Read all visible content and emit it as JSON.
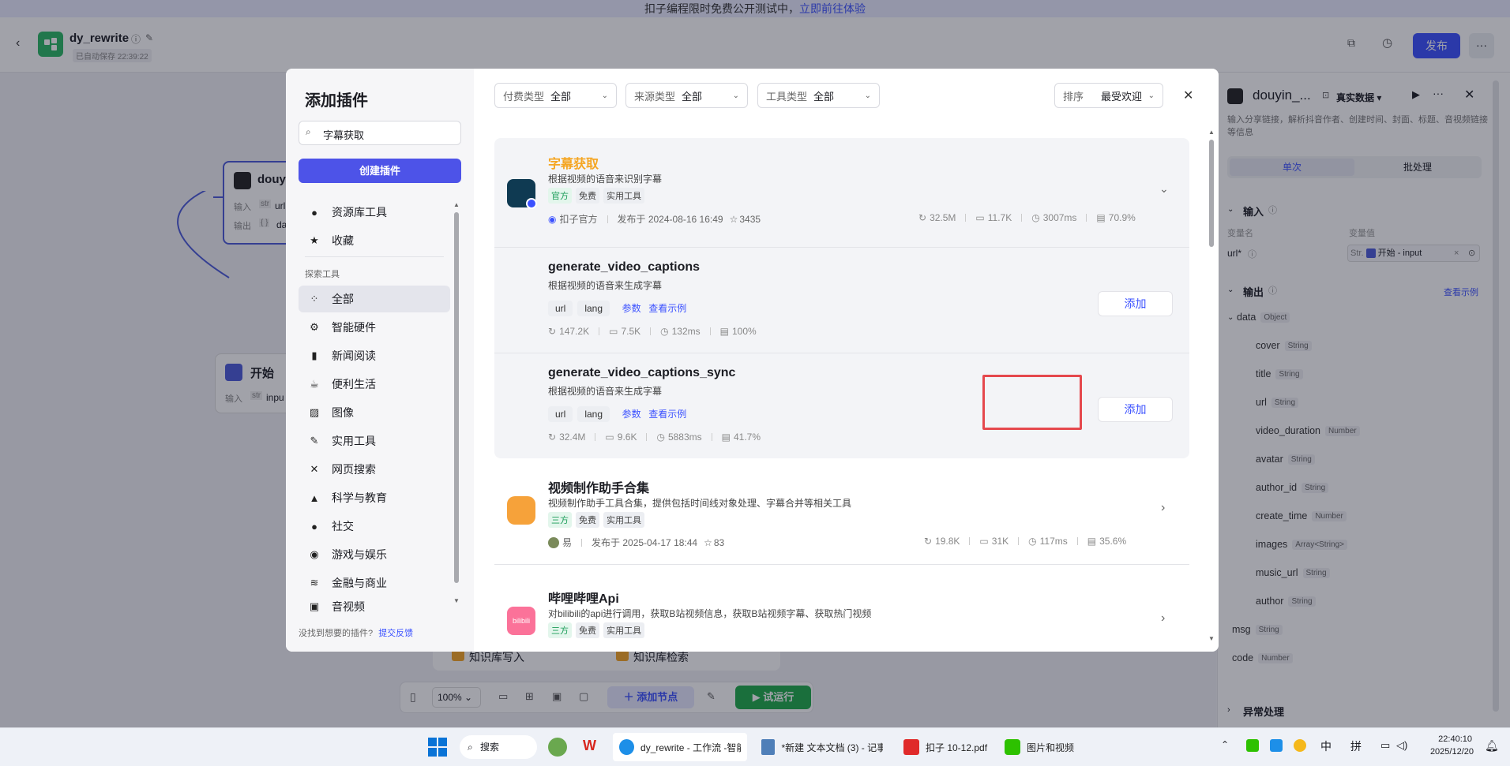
{
  "banner": {
    "text": "扣子编程限时免费公开测试中，",
    "link": "立即前往体验"
  },
  "topbar": {
    "app_name": "dy_rewrite",
    "autosave": "已自动保存 22:39:22",
    "publish": "发布"
  },
  "canvas": {
    "node1_title": "douy",
    "node1_in_label": "输入",
    "node1_in_type": "str",
    "node1_in_val": "url",
    "node1_out_label": "输出",
    "node1_out_type": "{ }",
    "node1_out_val": "da",
    "start_title": "开始",
    "start_in_label": "输入",
    "start_in_type": "str",
    "start_in_val": "inpu",
    "kb_write": "知识库写入",
    "kb_search": "知识库检索",
    "zoom": "100%",
    "add_node": "添加节点",
    "test_run": "试运行"
  },
  "modal": {
    "title": "添加插件",
    "search_value": "字幕获取",
    "create_button": "创建插件",
    "nav_top": [
      {
        "label": "资源库工具",
        "icon": "user-icon"
      },
      {
        "label": "收藏",
        "icon": "star-icon"
      }
    ],
    "explore_label": "探索工具",
    "nav_items": [
      {
        "label": "全部",
        "icon": "grid-icon",
        "active": true
      },
      {
        "label": "智能硬件",
        "icon": "chip-icon"
      },
      {
        "label": "新闻阅读",
        "icon": "book-icon"
      },
      {
        "label": "便利生活",
        "icon": "cup-icon"
      },
      {
        "label": "图像",
        "icon": "image-icon"
      },
      {
        "label": "实用工具",
        "icon": "wrench-icon"
      },
      {
        "label": "网页搜索",
        "icon": "network-icon"
      },
      {
        "label": "科学与教育",
        "icon": "graduation-icon"
      },
      {
        "label": "社交",
        "icon": "chat-icon"
      },
      {
        "label": "游戏与娱乐",
        "icon": "gamepad-icon"
      },
      {
        "label": "金融与商业",
        "icon": "coins-icon"
      },
      {
        "label": "音视频",
        "icon": "video-icon"
      }
    ],
    "feedback_text": "没找到想要的插件?",
    "feedback_link": "提交反馈",
    "filters": {
      "pay_label": "付费类型",
      "pay_value": "全部",
      "source_label": "来源类型",
      "source_value": "全部",
      "tool_label": "工具类型",
      "tool_value": "全部",
      "sort_label": "排序",
      "sort_value": "最受欢迎"
    },
    "plugin1": {
      "name": "字幕获取",
      "desc": "根据视频的语音来识别字幕",
      "tags": [
        "官方",
        "免费",
        "实用工具"
      ],
      "author": "扣子官方",
      "published": "发布于 2024-08-16 16:49",
      "favorites": "3435",
      "stats": [
        "32.5M",
        "11.7K",
        "3007ms",
        "70.9%"
      ]
    },
    "tool1": {
      "name": "generate_video_captions",
      "desc": "根据视频的语音来生成字幕",
      "params": [
        "url",
        "lang"
      ],
      "link_params": "参数",
      "link_example": "查看示例",
      "stats": [
        "147.2K",
        "7.5K",
        "132ms",
        "100%"
      ],
      "add": "添加"
    },
    "tool2": {
      "name": "generate_video_captions_sync",
      "desc": "根据视频的语音来生成字幕",
      "params": [
        "url",
        "lang"
      ],
      "link_params": "参数",
      "link_example": "查看示例",
      "stats": [
        "32.4M",
        "9.6K",
        "5883ms",
        "41.7%"
      ],
      "add": "添加"
    },
    "plugin2": {
      "name": "视频制作助手合集",
      "desc": "视频制作助手工具合集，提供包括时间线对象处理、字幕合并等相关工具",
      "tags": [
        "三方",
        "免费",
        "实用工具"
      ],
      "author": "易",
      "published": "发布于 2025-04-17 18:44",
      "favorites": "83",
      "stats": [
        "19.8K",
        "31K",
        "117ms",
        "35.6%"
      ]
    },
    "plugin3": {
      "name": "哔哩哔哩Api",
      "desc": "对bilibili的api进行调用，获取B站视频信息，获取B站视频字幕、获取热门视频",
      "tags": [
        "三方",
        "免费",
        "实用工具"
      ],
      "logo_text": "bilibili"
    }
  },
  "right_panel": {
    "title": "douyin_...",
    "data_mode": "真实数据",
    "description": "输入分享链接，解析抖音作者、创建时间、封面、标题、音视频链接等信息",
    "tab_single": "单次",
    "tab_batch": "批处理",
    "input_section": "输入",
    "col_name": "变量名",
    "col_value": "变量值",
    "input_field": "url*",
    "input_value_type": "Str.",
    "input_value": "开始 - input",
    "output_section": "输出",
    "view_example": "查看示例",
    "outputs": [
      {
        "name": "data",
        "type": "Object",
        "level": 0
      },
      {
        "name": "cover",
        "type": "String",
        "level": 1
      },
      {
        "name": "title",
        "type": "String",
        "level": 1
      },
      {
        "name": "url",
        "type": "String",
        "level": 1
      },
      {
        "name": "video_duration",
        "type": "Number",
        "level": 1
      },
      {
        "name": "avatar",
        "type": "String",
        "level": 1
      },
      {
        "name": "author_id",
        "type": "String",
        "level": 1
      },
      {
        "name": "create_time",
        "type": "Number",
        "level": 1
      },
      {
        "name": "images",
        "type": "Array<String>",
        "level": 1
      },
      {
        "name": "music_url",
        "type": "String",
        "level": 1
      },
      {
        "name": "author",
        "type": "String",
        "level": 1
      },
      {
        "name": "msg",
        "type": "String",
        "level": 0
      },
      {
        "name": "code",
        "type": "Number",
        "level": 0
      }
    ],
    "exception_section": "异常处理"
  },
  "taskbar": {
    "search": "搜索",
    "apps": [
      {
        "label": "dy_rewrite - 工作流 -智能"
      },
      {
        "label": "*新建 文本文档 (3) - 记事"
      },
      {
        "label": "扣子 10-12.pdf"
      },
      {
        "label": "图片和视频"
      }
    ],
    "ime1": "中",
    "ime2": "拼",
    "time": "22:40:10",
    "date": "2025/12/20"
  },
  "colors": {
    "accent": "#3b51ff",
    "highlight": "#e5484d",
    "orange": "#f5a623",
    "run_green": "#1fab4a"
  }
}
